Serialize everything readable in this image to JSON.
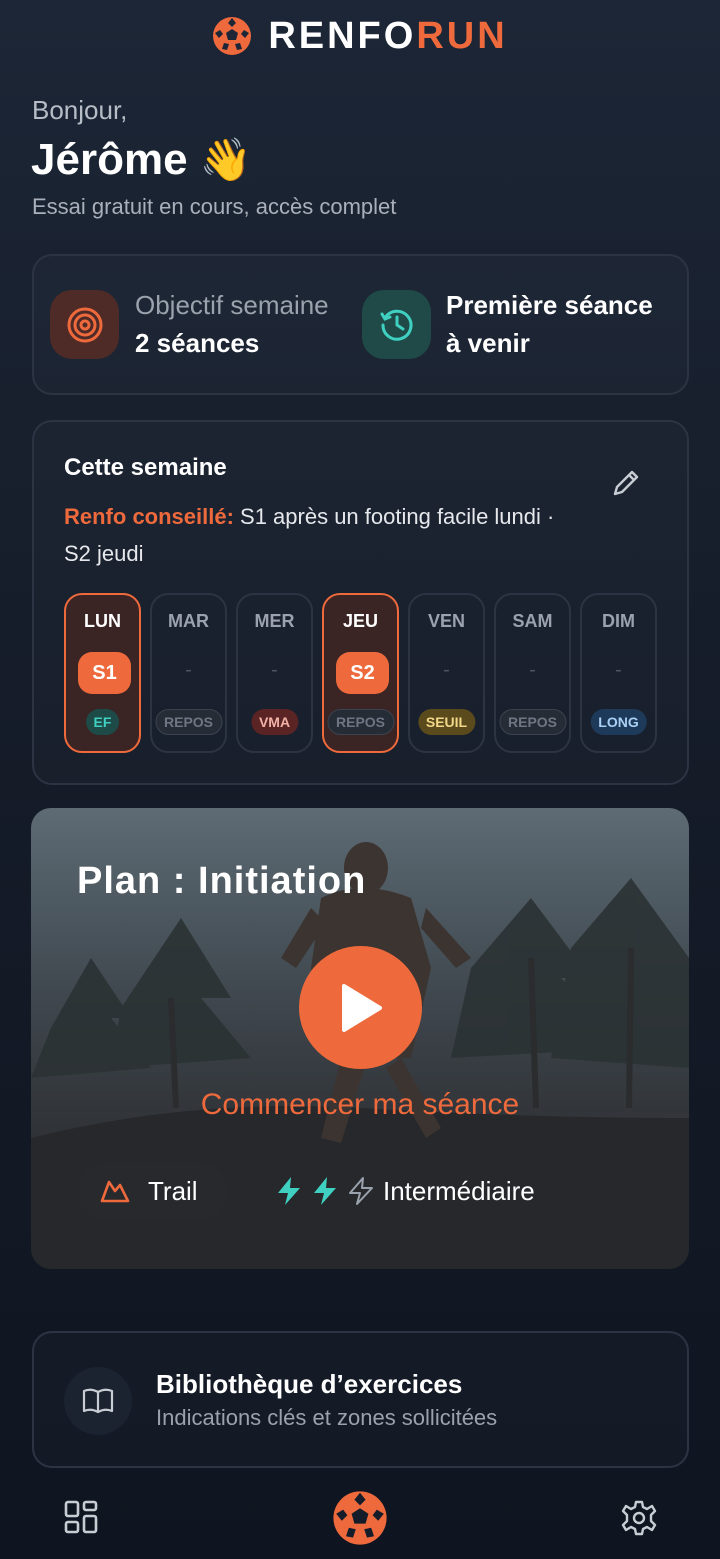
{
  "brand": {
    "part1": "RENFO",
    "part2": "RUN",
    "logo_icon": "hexagon-ball-icon"
  },
  "greeting": {
    "hello": "Bonjour,",
    "name": "Jérôme",
    "emoji": "👋",
    "subtitle": "Essai gratuit en cours, accès complet"
  },
  "stats": {
    "goal_label": "Objectif semaine",
    "goal_value": "2 séances",
    "goal_icon": "target-icon",
    "next_line1": "Première séance",
    "next_line2": "à venir",
    "next_icon": "clock-history-icon"
  },
  "week": {
    "title": "Cette semaine",
    "advice_highlight": "Renfo conseillé:",
    "advice_text": " S1 après un footing facile lundi · S2 jeudi",
    "edit_icon": "pencil-icon",
    "days": [
      {
        "name": "LUN",
        "session": "S1",
        "tag": "EF",
        "active": true
      },
      {
        "name": "MAR",
        "session": "-",
        "tag": "REPOS",
        "active": false
      },
      {
        "name": "MER",
        "session": "-",
        "tag": "VMA",
        "active": false
      },
      {
        "name": "JEU",
        "session": "S2",
        "tag": "REPOS",
        "active": true
      },
      {
        "name": "VEN",
        "session": "-",
        "tag": "SEUIL",
        "active": false
      },
      {
        "name": "SAM",
        "session": "-",
        "tag": "REPOS",
        "active": false
      },
      {
        "name": "DIM",
        "session": "-",
        "tag": "LONG",
        "active": false
      }
    ]
  },
  "plan": {
    "title": "Plan : Initiation",
    "cta": "Commencer ma séance",
    "discipline": "Trail",
    "discipline_icon": "mountain-icon",
    "level": "Intermédiaire",
    "level_value": 2,
    "level_max": 3,
    "play_icon": "play-icon"
  },
  "library": {
    "title": "Bibliothèque d’exercices",
    "subtitle": "Indications clés et zones sollicitées",
    "icon": "book-icon"
  },
  "nav": {
    "left_icon": "grid-icon",
    "center_icon": "hexagon-ball-icon",
    "right_icon": "gear-icon"
  },
  "colors": {
    "accent": "#ee6a3c",
    "teal": "#3fd0c1",
    "bg": "#161d2a"
  }
}
